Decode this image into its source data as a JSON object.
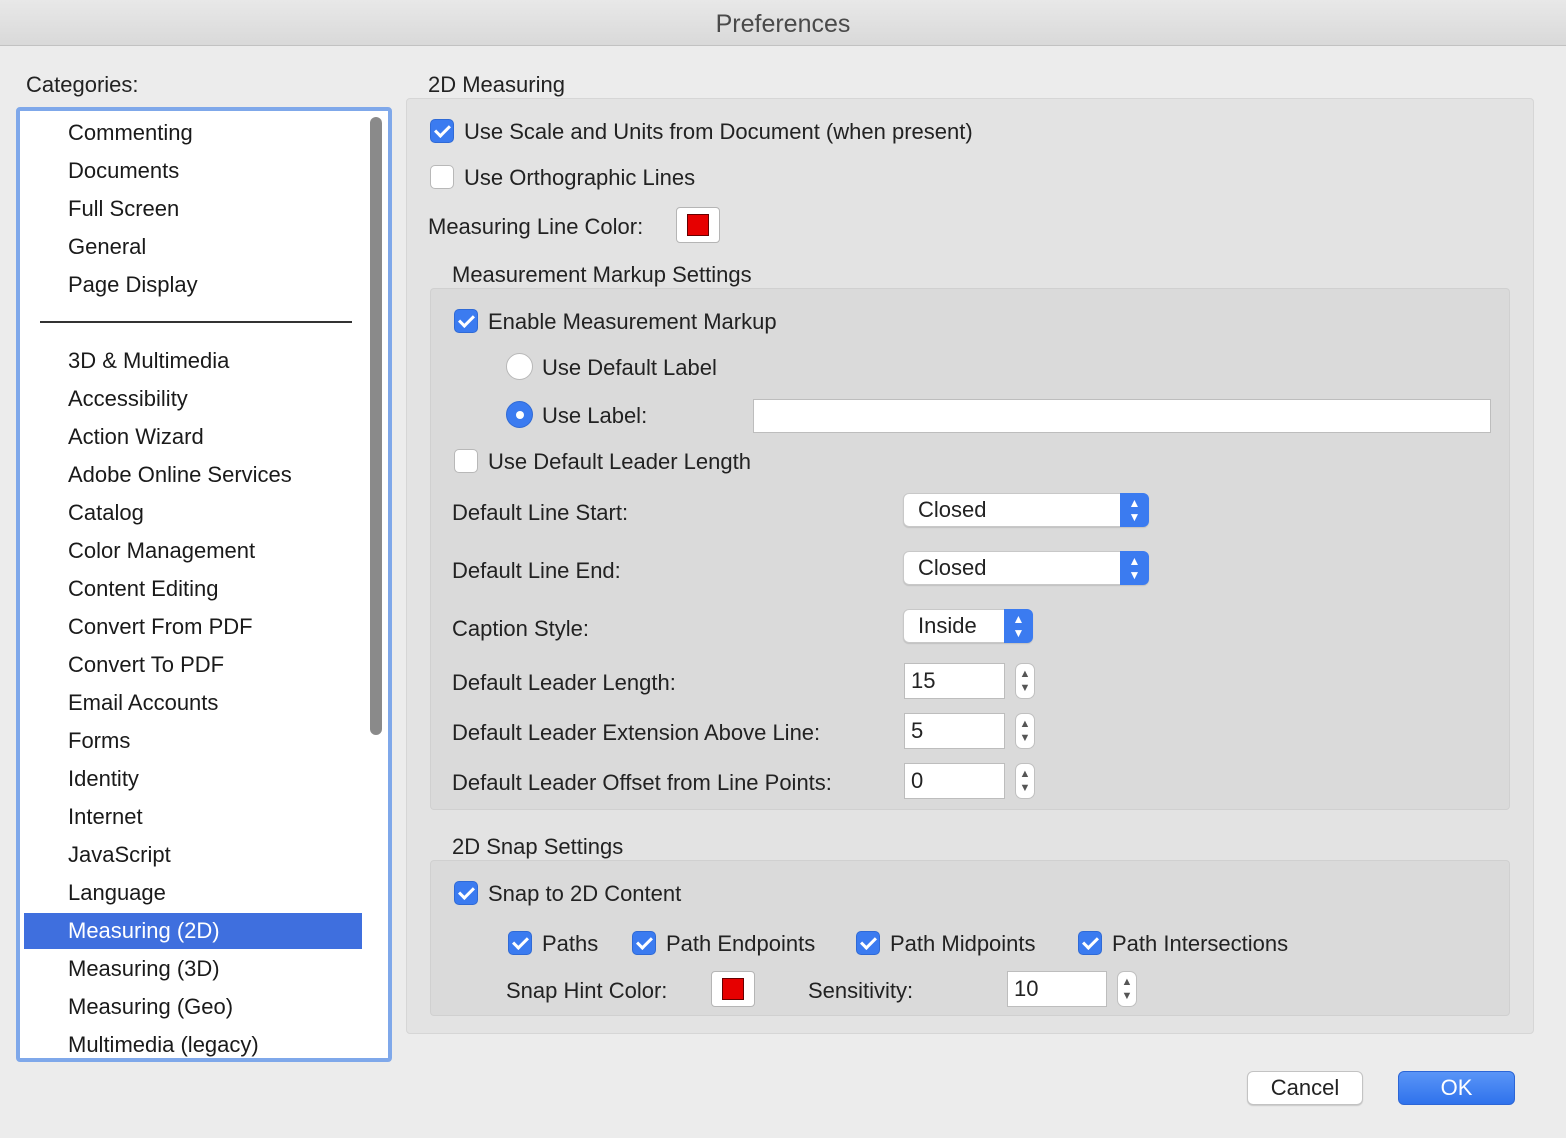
{
  "window": {
    "title": "Preferences"
  },
  "categories": {
    "label": "Categories:",
    "group1": [
      "Commenting",
      "Documents",
      "Full Screen",
      "General",
      "Page Display"
    ],
    "group2": [
      "3D & Multimedia",
      "Accessibility",
      "Action Wizard",
      "Adobe Online Services",
      "Catalog",
      "Color Management",
      "Content Editing",
      "Convert From PDF",
      "Convert To PDF",
      "Email Accounts",
      "Forms",
      "Identity",
      "Internet",
      "JavaScript",
      "Language",
      "Measuring (2D)",
      "Measuring (3D)",
      "Measuring (Geo)",
      "Multimedia (legacy)"
    ],
    "selected": "Measuring (2D)"
  },
  "measuring": {
    "section_title": "2D Measuring",
    "use_scale_label": "Use Scale and Units from Document (when present)",
    "use_scale_checked": true,
    "ortho_label": "Use Orthographic Lines",
    "ortho_checked": false,
    "line_color_label": "Measuring Line Color:",
    "line_color": "#e60000"
  },
  "markup": {
    "section_title": "Measurement Markup Settings",
    "enable_label": "Enable Measurement Markup",
    "enable_checked": true,
    "default_label_option": "Use Default Label",
    "use_label_option": "Use Label:",
    "use_label_selected": true,
    "use_label_value": "",
    "default_leader_label": "Use Default Leader Length",
    "default_leader_checked": false,
    "line_start_label": "Default Line Start:",
    "line_start_value": "Closed",
    "line_end_label": "Default Line End:",
    "line_end_value": "Closed",
    "caption_label": "Caption Style:",
    "caption_value": "Inside",
    "leader_length_label": "Default Leader Length:",
    "leader_length_value": "15",
    "leader_ext_label": "Default Leader Extension Above Line:",
    "leader_ext_value": "5",
    "leader_offset_label": "Default Leader Offset from Line Points:",
    "leader_offset_value": "0"
  },
  "snap": {
    "section_title": "2D Snap Settings",
    "snap_label": "Snap to 2D Content",
    "snap_checked": true,
    "paths_label": "Paths",
    "endpoints_label": "Path Endpoints",
    "midpoints_label": "Path Midpoints",
    "intersections_label": "Path Intersections",
    "hint_color_label": "Snap Hint Color:",
    "hint_color": "#e60000",
    "sensitivity_label": "Sensitivity:",
    "sensitivity_value": "10"
  },
  "buttons": {
    "cancel": "Cancel",
    "ok": "OK"
  },
  "colors": {
    "accent": "#3b7bf0",
    "selection": "#3f6fde"
  }
}
